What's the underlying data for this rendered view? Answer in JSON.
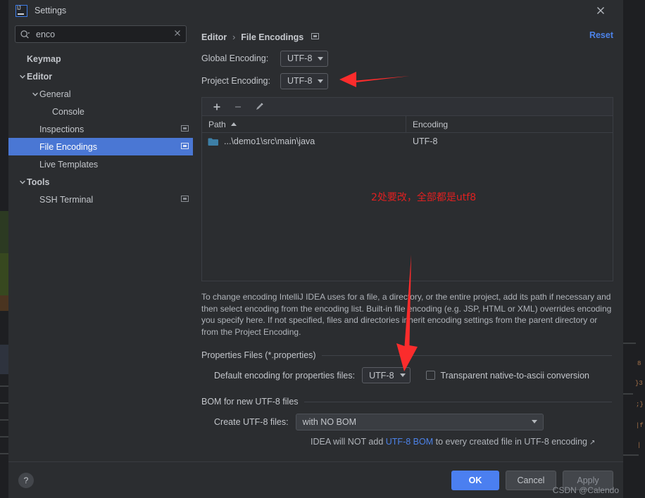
{
  "window": {
    "title": "Settings",
    "logo_text": "IJ",
    "close_icon": "close-icon"
  },
  "search": {
    "value": "enco",
    "placeholder": "Search settings",
    "icon": "search-icon",
    "clear_icon": "close-icon"
  },
  "sidebar": {
    "items": [
      {
        "label": "Keymap",
        "indent": 1,
        "bold": true,
        "chevron": "",
        "selected": false,
        "badge": false
      },
      {
        "label": "Editor",
        "indent": 1,
        "bold": true,
        "chevron": "down",
        "selected": false,
        "badge": false
      },
      {
        "label": "General",
        "indent": 2,
        "bold": false,
        "chevron": "down",
        "selected": false,
        "badge": false
      },
      {
        "label": "Console",
        "indent": 3,
        "bold": false,
        "chevron": "",
        "selected": false,
        "badge": false
      },
      {
        "label": "Inspections",
        "indent": 2,
        "bold": false,
        "chevron": "",
        "selected": false,
        "badge": true
      },
      {
        "label": "File Encodings",
        "indent": 2,
        "bold": false,
        "chevron": "",
        "selected": true,
        "badge": true
      },
      {
        "label": "Live Templates",
        "indent": 2,
        "bold": false,
        "chevron": "",
        "selected": false,
        "badge": false
      },
      {
        "label": "Tools",
        "indent": 1,
        "bold": true,
        "chevron": "down",
        "selected": false,
        "badge": false
      },
      {
        "label": "SSH Terminal",
        "indent": 2,
        "bold": false,
        "chevron": "",
        "selected": false,
        "badge": true
      }
    ]
  },
  "main": {
    "breadcrumb": {
      "parent": "Editor",
      "separator": "›",
      "current": "File Encodings"
    },
    "reset_label": "Reset",
    "global_encoding": {
      "label": "Global Encoding:",
      "value": "UTF-8"
    },
    "project_encoding": {
      "label": "Project Encoding:",
      "value": "UTF-8"
    },
    "toolbar": {
      "add_icon": "plus-icon",
      "remove_icon": "minus-icon",
      "edit_icon": "pencil-icon"
    },
    "table": {
      "columns": [
        "Path",
        "Encoding"
      ],
      "sort_column": "Path",
      "sort_direction": "asc",
      "rows": [
        {
          "path": "...\\demo1\\src\\main\\java",
          "encoding": "UTF-8",
          "icon": "folder-icon"
        }
      ]
    },
    "description": "To change encoding IntelliJ IDEA uses for a file, a directory, or the entire project, add its path if necessary and then select encoding from the encoding list. Built-in file encoding (e.g. JSP, HTML or XML) overrides encoding you specify here. If not specified, files and directories inherit encoding settings from the parent directory or from the Project Encoding.",
    "properties_section": {
      "title": "Properties Files (*.properties)",
      "default_encoding_label": "Default encoding for properties files:",
      "default_encoding_value": "UTF-8",
      "transparent_label": "Transparent native-to-ascii conversion",
      "transparent_checked": false
    },
    "bom_section": {
      "title": "BOM for new UTF-8 files",
      "create_label": "Create UTF-8 files:",
      "create_value": "with NO BOM",
      "hint_prefix": "IDEA will NOT add ",
      "hint_link": "UTF-8 BOM",
      "hint_suffix": " to every created file in UTF-8 encoding",
      "hint_external_icon": "↗"
    }
  },
  "footer": {
    "help_label": "?",
    "ok_label": "OK",
    "cancel_label": "Cancel",
    "apply_label": "Apply"
  },
  "annotations": {
    "chinese_note": "2处要改，全部都是utf8",
    "arrow_left": "arrow-left-icon",
    "arrow_down": "arrow-down-icon",
    "color": "#e02020"
  },
  "watermark": "CSDN @Calendo",
  "colors": {
    "accent_blue": "#4c82e8",
    "selection_blue": "#4a77d4",
    "ok_button": "#4b7ff0",
    "panel_bg": "#2b2d30",
    "annotation_red": "#e02020"
  }
}
